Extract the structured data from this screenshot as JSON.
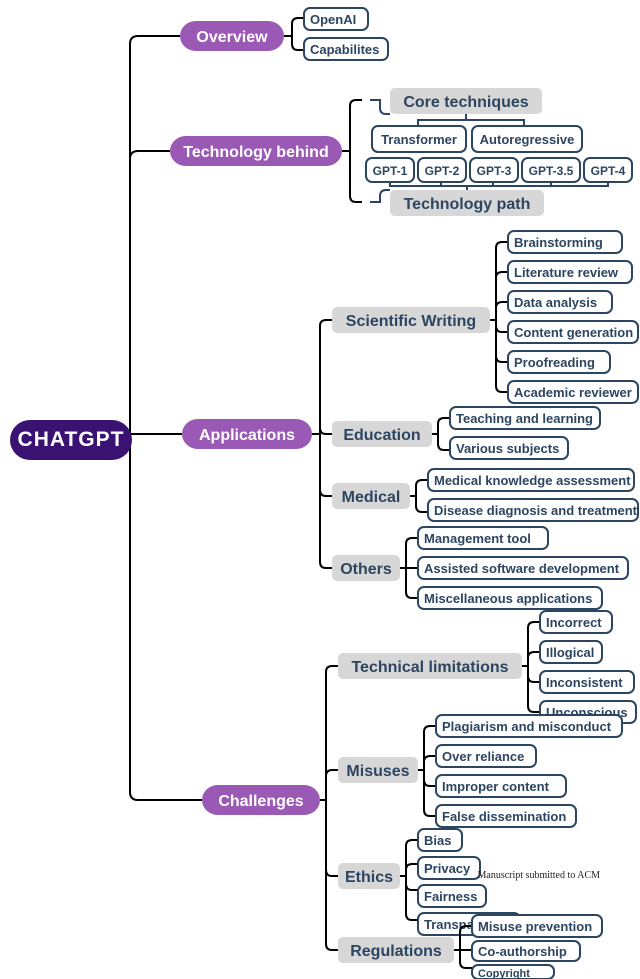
{
  "root": "CHATGPT",
  "sections": {
    "overview": {
      "label": "Overview"
    },
    "technology": {
      "label": "Technology behind"
    },
    "applications": {
      "label": "Applications"
    },
    "challenges": {
      "label": "Challenges"
    }
  },
  "overview": [
    "OpenAI",
    "Capabilites"
  ],
  "technology": {
    "core_label": "Core techniques",
    "core": [
      "Transformer",
      "Autoregressive"
    ],
    "path_label": "Technology path",
    "path": [
      "GPT-1",
      "GPT-2",
      "GPT-3",
      "GPT-3.5",
      "GPT-4"
    ]
  },
  "applications": {
    "scientific": {
      "label": "Scientific Writing",
      "items": [
        "Brainstorming",
        "Literature review",
        "Data analysis",
        "Content generation",
        "Proofreading",
        "Academic reviewer"
      ]
    },
    "education": {
      "label": "Education",
      "items": [
        "Teaching and learning",
        "Various subjects"
      ]
    },
    "medical": {
      "label": "Medical",
      "items": [
        "Medical knowledge assessment",
        "Disease diagnosis and treatment"
      ]
    },
    "others": {
      "label": "Others",
      "items": [
        "Management tool",
        "Assisted software development",
        "Miscellaneous applications"
      ]
    }
  },
  "challenges": {
    "technical": {
      "label": "Technical limitations",
      "items": [
        "Incorrect",
        "Illogical",
        "Inconsistent",
        "Unconscious"
      ]
    },
    "misuses": {
      "label": "Misuses",
      "items": [
        "Plagiarism and misconduct",
        "Over reliance",
        "Improper content",
        "False dissemination"
      ]
    },
    "ethics": {
      "label": "Ethics",
      "items": [
        "Bias",
        "Privacy",
        "Fairness",
        "Transparency"
      ]
    },
    "regulations": {
      "label": "Regulations",
      "items": [
        "Misuse prevention",
        "Co-authorship",
        "Copyright"
      ]
    }
  },
  "footer": "Manuscript submitted to ACM"
}
